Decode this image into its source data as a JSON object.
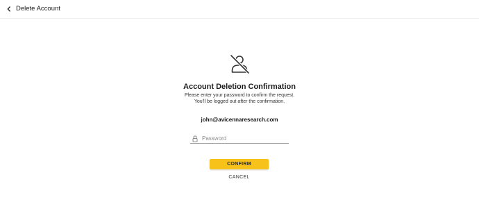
{
  "header": {
    "back_icon": "chevron-left-icon",
    "title": "Delete Account"
  },
  "main": {
    "hero_icon": "user-off-icon",
    "title": "Account Deletion Confirmation",
    "subtitle_line1": "Please enter your password to confirm the request.",
    "subtitle_line2": "You'll be logged out after the confirmation.",
    "email": "john@avicennaresearch.com",
    "password": {
      "icon": "lock-icon",
      "value": "",
      "placeholder": "Password"
    },
    "confirm_label": "CONFIRM",
    "cancel_label": "CANCEL"
  },
  "colors": {
    "accent": "#f7c21a",
    "text": "#1b1b1b",
    "underline": "#9b9b9b"
  }
}
